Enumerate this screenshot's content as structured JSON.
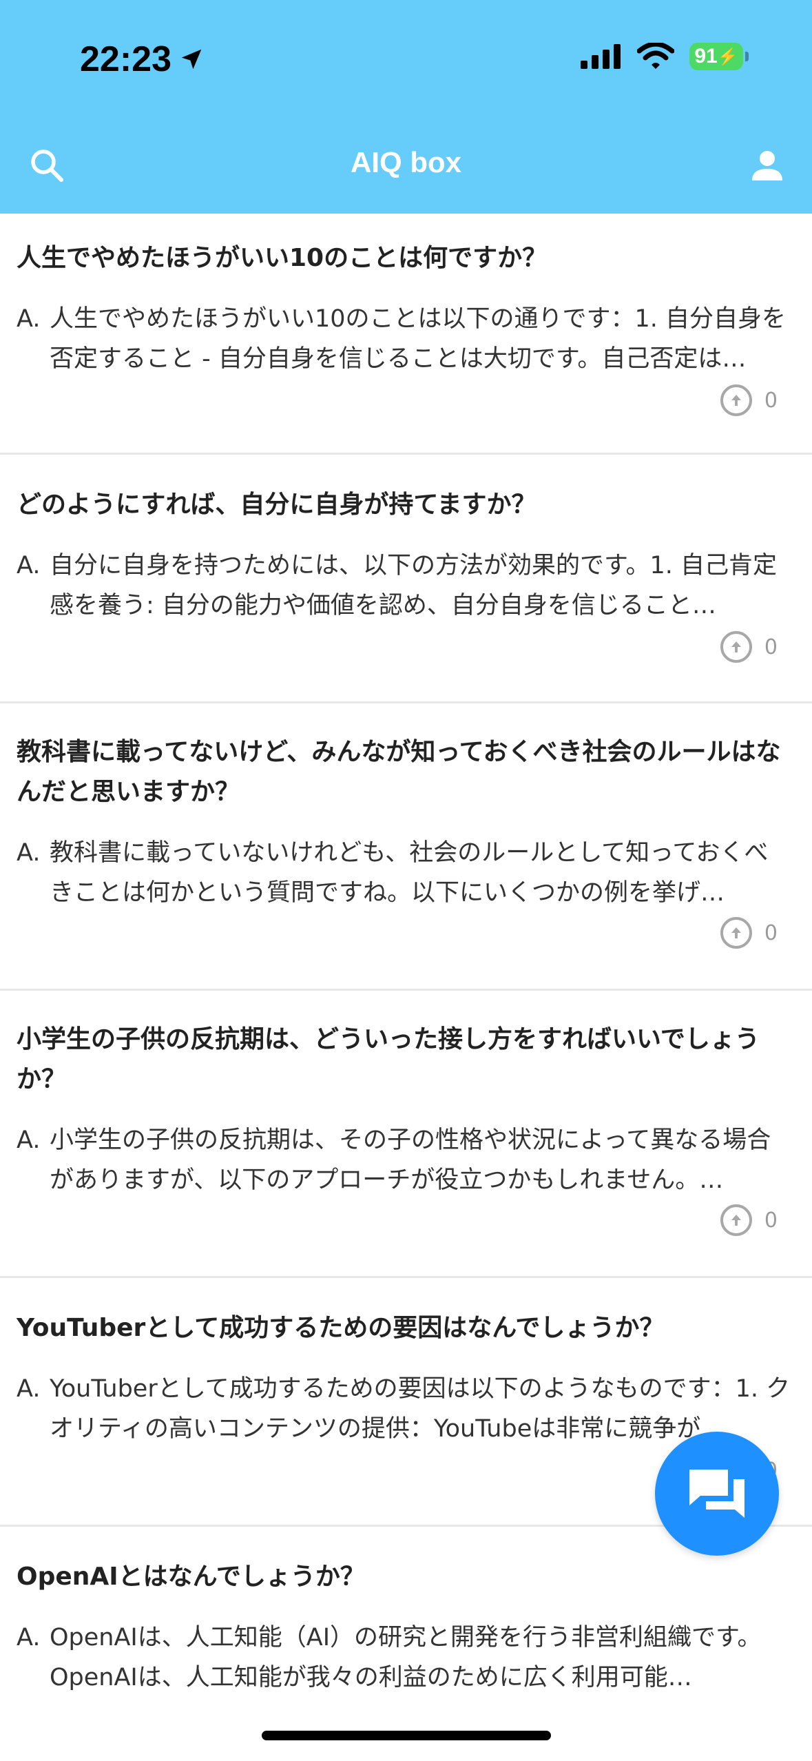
{
  "status_bar": {
    "time": "22:23",
    "battery": "91"
  },
  "nav": {
    "title": "AIQ box",
    "search_icon": "search-icon",
    "user_icon": "user-icon"
  },
  "answer_prefix": "A.",
  "cards": [
    {
      "question": "人生でやめたほうがいい10のことは何ですか？",
      "answer": "人生でやめたほうがいい10のことは以下の通りです：1. 自分自身を否定すること - 自分自身を信じることは大切です。自己否定は…",
      "votes": "0"
    },
    {
      "question": "どのようにすれば、自分に自身が持てますか？",
      "answer": "自分に自身を持つためには、以下の方法が効果的です。1. 自己肯定感を養う: 自分の能力や価値を認め、自分自身を信じること…",
      "votes": "0"
    },
    {
      "question": "教科書に載ってないけど、みんなが知っておくべき社会のルールはなんだと思いますか？",
      "answer": "教科書に載っていないけれども、社会のルールとして知っておくべきことは何かという質問ですね。以下にいくつかの例を挙げ…",
      "votes": "0"
    },
    {
      "question": "小学生の子供の反抗期は、どういった接し方をすればいいでしょうか？",
      "answer": "小学生の子供の反抗期は、その子の性格や状況によって異なる場合がありますが、以下のアプローチが役立つかもしれません。…",
      "votes": "0"
    },
    {
      "question": "YouTuberとして成功するための要因はなんでしょうか？",
      "answer": "YouTuberとして成功するための要因は以下のようなものです：1. クオリティの高いコンテンツの提供：YouTubeは非常に競争が…",
      "votes": "0"
    },
    {
      "question": "OpenAIとはなんでしょうか？",
      "answer": "OpenAIは、人工知能（AI）の研究と開発を行う非営利組織です。OpenAIは、人工知能が我々の利益のために広く利用可能…",
      "votes": ""
    }
  ],
  "colors": {
    "header": "#66cdfb",
    "fab": "#1e90ff"
  }
}
